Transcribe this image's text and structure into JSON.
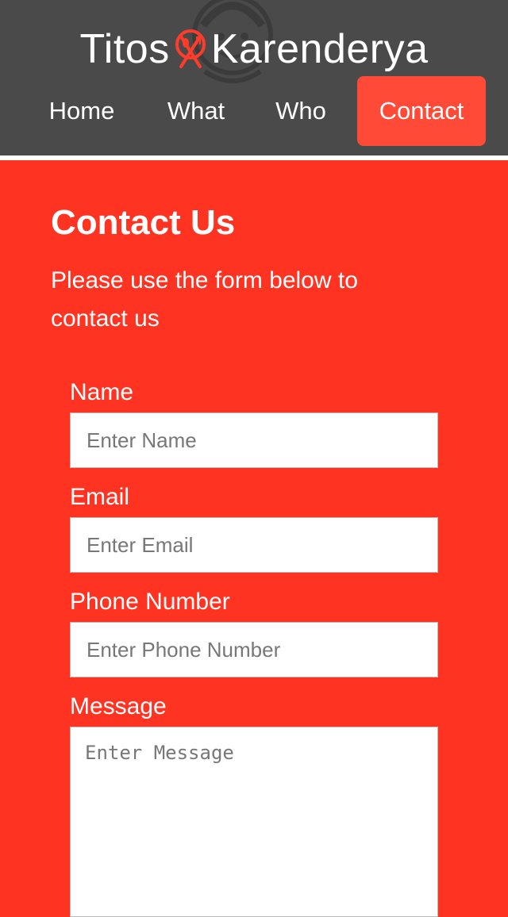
{
  "brand": {
    "name_left": "Titos",
    "name_right": "Karenderya",
    "logo_icon": "fork-spoon-icon",
    "accent": "#ff4a38"
  },
  "nav": {
    "items": [
      {
        "label": "Home"
      },
      {
        "label": "What"
      },
      {
        "label": "Who"
      },
      {
        "label": "Contact",
        "active": true
      }
    ]
  },
  "contact": {
    "title": "Contact Us",
    "subtitle": "Please use the form below to contact us",
    "fields": {
      "name": {
        "label": "Name",
        "placeholder": "Enter Name"
      },
      "email": {
        "label": "Email",
        "placeholder": "Enter Email"
      },
      "phone": {
        "label": "Phone Number",
        "placeholder": "Enter Phone Number"
      },
      "message": {
        "label": "Message",
        "placeholder": "Enter Message"
      }
    }
  },
  "colors": {
    "header_bg": "#4a4a4a",
    "page_bg": "#ff3322",
    "active_tab": "#ff4a38"
  }
}
